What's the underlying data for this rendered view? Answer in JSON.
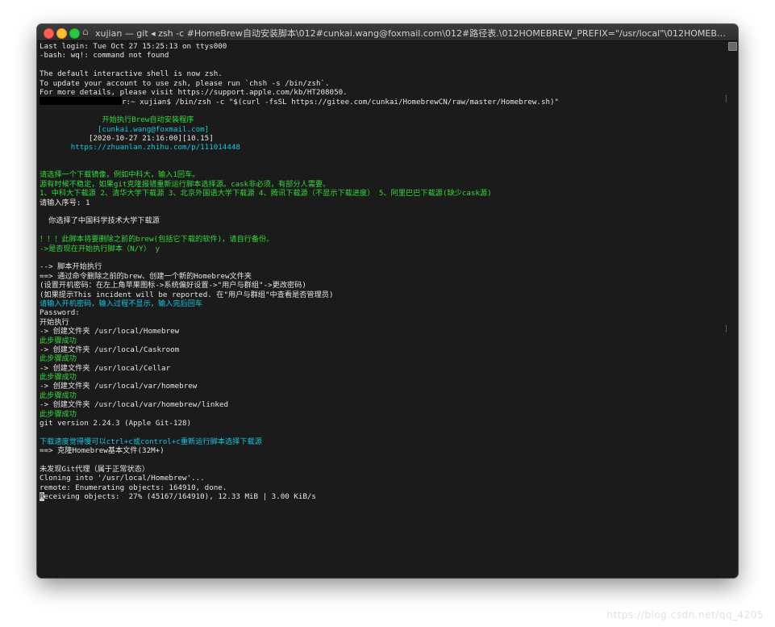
{
  "window": {
    "title": "xujian — git ◂ zsh -c #HomeBrew自动安装脚本\\012#cunkai.wang@foxmail.com\\012#路径表.\\012HOMEBREW_PREFIX=\"/usr/local\"\\012HOMEBREW_REPOSITORY=\"$..."
  },
  "terminal": {
    "lines": [
      {
        "text": "Last login: Tue Oct 27 15:25:13 on ttys000",
        "color": "white"
      },
      {
        "text": "-bash: wq!: command not found",
        "color": "white"
      },
      {
        "text": "",
        "color": "white"
      },
      {
        "text": "The default interactive shell is now zsh.",
        "color": "white"
      },
      {
        "text": "To update your account to use zsh, please run `chsh -s /bin/zsh`.",
        "color": "white"
      },
      {
        "text": "For more details, please visit https://support.apple.com/kb/HT208050.",
        "color": "white"
      },
      {
        "text": "r:~ xujian$ /bin/zsh -c \"$(curl -fsSL https://gitee.com/cunkai/HomebrewCN/raw/master/Homebrew.sh)\"",
        "color": "white",
        "redacted_prefix": true
      },
      {
        "text": "",
        "color": "white"
      },
      {
        "text": "              开始执行Brew自动安装程序",
        "color": "green"
      },
      {
        "text": "             [cunkai.wang@foxmail.com]",
        "color": "cyan"
      },
      {
        "text": "           [2020-10-27 21:16:00][10.15]",
        "color": "white"
      },
      {
        "text": "       https://zhuanlan.zhihu.com/p/111014448",
        "color": "cyan"
      },
      {
        "text": "",
        "color": "white"
      },
      {
        "text": "",
        "color": "white"
      },
      {
        "text": "请选择一个下载镜像，例如中科大，输入1回车。",
        "color": "green"
      },
      {
        "text": "源有时候不稳定，如果git克隆报错重新运行脚本选择源。cask非必须，有部分人需要。",
        "color": "green"
      },
      {
        "text": "1、中科大下载源 2、清华大学下载源 3、北京外国语大学下载源 4、腾讯下载源（不显示下载进度） 5、阿里巴巴下载源(缺少cask源)",
        "color": "green"
      },
      {
        "text": "请输入序号: 1",
        "color": "white"
      },
      {
        "text": "",
        "color": "white"
      },
      {
        "text": "  你选择了中国科学技术大学下载源",
        "color": "white"
      },
      {
        "text": "",
        "color": "white"
      },
      {
        "text": "！！！此脚本将要删除之前的brew(包括它下载的软件)，请自行备份。",
        "color": "green"
      },
      {
        "text": "->是否现在开始执行脚本（N/Y） y",
        "color": "green"
      },
      {
        "text": "",
        "color": "white"
      },
      {
        "text": "--> 脚本开始执行",
        "color": "white"
      },
      {
        "text": "==> 通过命令删除之前的brew、创建一个新的Homebrew文件夹",
        "color": "white"
      },
      {
        "text": "(设置开机密码：在左上角苹果图标->系统偏好设置->\"用户与群组\"->更改密码)",
        "color": "white"
      },
      {
        "text": "(如果提示This incident will be reported. 在\"用户与群组\"中查看是否管理员)",
        "color": "white"
      },
      {
        "text": "请输入开机密码，输入过程不显示，输入完后回车",
        "color": "cyan"
      },
      {
        "text": "Password:",
        "color": "white"
      },
      {
        "text": "开始执行",
        "color": "white"
      },
      {
        "text": "-> 创建文件夹 /usr/local/Homebrew",
        "color": "white"
      },
      {
        "text": "此步骤成功",
        "color": "green"
      },
      {
        "text": "-> 创建文件夹 /usr/local/Caskroom",
        "color": "white"
      },
      {
        "text": "此步骤成功",
        "color": "green"
      },
      {
        "text": "-> 创建文件夹 /usr/local/Cellar",
        "color": "white"
      },
      {
        "text": "此步骤成功",
        "color": "green"
      },
      {
        "text": "-> 创建文件夹 /usr/local/var/homebrew",
        "color": "white"
      },
      {
        "text": "此步骤成功",
        "color": "green"
      },
      {
        "text": "-> 创建文件夹 /usr/local/var/homebrew/linked",
        "color": "white"
      },
      {
        "text": "此步骤成功",
        "color": "green"
      },
      {
        "text": "git version 2.24.3 (Apple Git-128)",
        "color": "white"
      },
      {
        "text": "",
        "color": "white"
      },
      {
        "text": "下载速度觉得慢可以ctrl+c或control+c重新运行脚本选择下载源",
        "color": "cyan"
      },
      {
        "text": "==> 克隆Homebrew基本文件(32M+)",
        "color": "white"
      },
      {
        "text": "",
        "color": "white"
      },
      {
        "text": "未发现Git代理（属于正常状态）",
        "color": "white"
      },
      {
        "text": "Cloning into '/usr/local/Homebrew'...",
        "color": "white"
      },
      {
        "text": "remote: Enumerating objects: 164910, done.",
        "color": "white"
      },
      {
        "text": "Receiving objects:  27% (45167/164910), 12.33 MiB | 3.00 KiB/s",
        "color": "white",
        "cursor_first_char": true
      }
    ]
  },
  "watermark": "https://blog.csdn.net/qq_4205"
}
